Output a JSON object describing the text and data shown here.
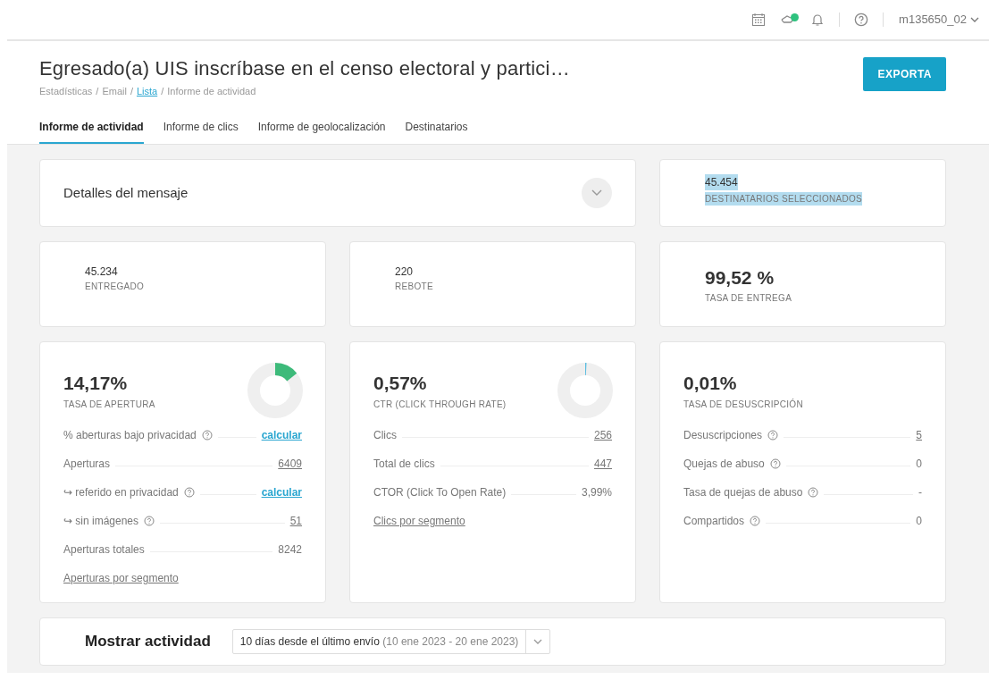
{
  "topbar": {
    "notification_dot": true,
    "user": "m135650_02"
  },
  "header": {
    "title": "Egresado(a) UIS inscríbase en el censo electoral y partici…",
    "export_button": "EXPORTA",
    "breadcrumb": [
      {
        "label": "Estadísticas",
        "link": false
      },
      {
        "separator": "/",
        "label": "Email",
        "link": false
      },
      {
        "separator": "/",
        "label": "Lista",
        "link": true
      },
      {
        "separator": "/",
        "label": "Informe de actividad",
        "link": false
      }
    ]
  },
  "tabs": [
    {
      "label": "Informe de actividad",
      "selected": true
    },
    {
      "label": "Informe de clics",
      "selected": false
    },
    {
      "label": "Informe de geolocalización",
      "selected": false
    },
    {
      "label": "Destinatarios",
      "selected": false
    }
  ],
  "message_details": {
    "label": "Detalles del mensaje",
    "expanded": false
  },
  "recipients": {
    "value": "45.454",
    "label": "DESTINATARIOS SELECCIONADOS",
    "highlighted": true
  },
  "summary": [
    {
      "value": "45.234",
      "label": "ENTREGADO",
      "large": false
    },
    {
      "value": "220",
      "label": "REBOTE",
      "large": false
    },
    {
      "value": "99,52 %",
      "label": "TASA DE ENTREGA",
      "large": true
    }
  ],
  "panels": [
    {
      "value": "14,17%",
      "label": "TASA DE APERTURA",
      "donut": {
        "level": 0.1417,
        "color": "#3dba7a"
      },
      "rows": [
        {
          "label": "% aberturas bajo privacidad",
          "help": true,
          "value": "calcular",
          "kind": "action"
        },
        {
          "label": "Aperturas",
          "help": false,
          "value": "6409",
          "kind": "link"
        },
        {
          "label": "↪ referido en privacidad",
          "help": true,
          "value": "calcular",
          "kind": "action"
        },
        {
          "label": "↪ sin imágenes",
          "help": true,
          "value": "51",
          "kind": "link"
        },
        {
          "label": "Aperturas totales",
          "help": false,
          "value": "8242",
          "kind": "plain"
        }
      ],
      "footer_link": "Aperturas por segmento"
    },
    {
      "value": "0,57%",
      "label": "CTR (CLICK THROUGH RATE)",
      "donut": {
        "level": 0.0057,
        "color": "#5bbde0"
      },
      "rows": [
        {
          "label": "Clics",
          "help": false,
          "value": "256",
          "kind": "link"
        },
        {
          "label": "Total de clics",
          "help": false,
          "value": "447",
          "kind": "link"
        },
        {
          "label": "CTOR (Click To Open Rate)",
          "help": false,
          "value": "3,99%",
          "kind": "plain"
        }
      ],
      "footer_link": "Clics por segmento"
    },
    {
      "value": "0,01%",
      "label": "TASA DE DESUSCRIPCIÓN",
      "rows": [
        {
          "label": "Desuscripciones",
          "help": true,
          "value": "5",
          "kind": "link"
        },
        {
          "label": "Quejas de abuso",
          "help": true,
          "value": "0",
          "kind": "plain"
        },
        {
          "label": "Tasa de quejas de abuso",
          "help": true,
          "value": "-",
          "kind": "plain"
        },
        {
          "label": "Compartidos",
          "help": true,
          "value": "0",
          "kind": "plain"
        }
      ]
    }
  ],
  "activity": {
    "label": "Mostrar actividad",
    "select_value": "10 días desde el último envío",
    "select_range": "(10 ene 2023 - 20 ene 2023)"
  }
}
